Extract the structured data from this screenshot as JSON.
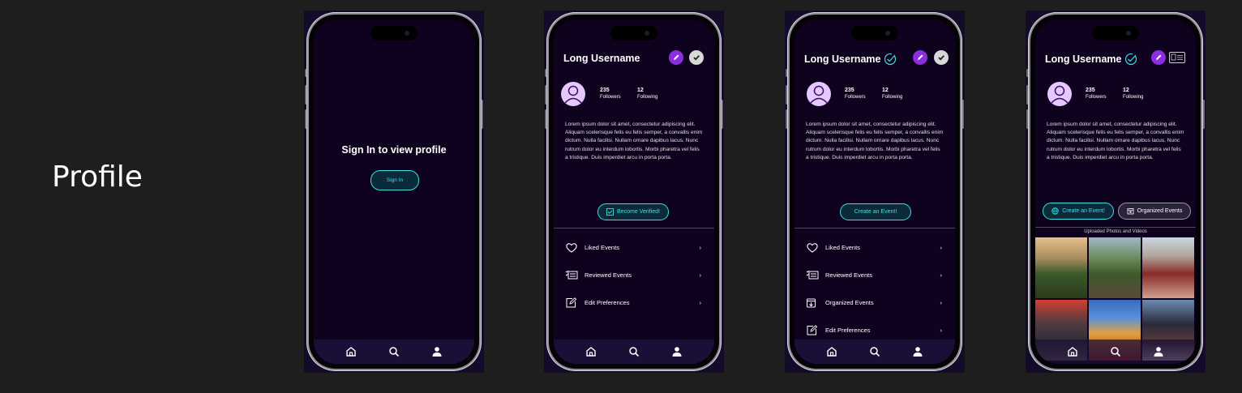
{
  "section_title": "Profile",
  "colors": {
    "background": "#1e1e1e",
    "screen": "#0e021e",
    "accent_cyan": "#3de0e0",
    "accent_purple": "#8b2ee0",
    "tabbar": "#1a0f36"
  },
  "phone1": {
    "title": "Sign In to view profile",
    "button": "Sign In"
  },
  "profile": {
    "username": "Long Username",
    "followers_count": "235",
    "followers_label": "Followers",
    "following_count": "12",
    "following_label": "Following",
    "bio": "Lorem ipsum dolor sit amet, consectetur adipiscing elit. Aliquam scelerisque felis eu felis semper, a convallis enim dictum. Nulla facilisi. Nullam ornare dapibus lacus. Nunc rutrum dolor eu interdum lobortis. Morbi pharetra vel felis a tristique. Duis imperdiet arcu in porta porta."
  },
  "phone2": {
    "button": "Become Verified!",
    "menu": [
      "Liked Events",
      "Reviewed Events",
      "Edit Preferences"
    ]
  },
  "phone3": {
    "button": "Create an Event!",
    "menu": [
      "Liked Events",
      "Reviewed Events",
      "Organized Events",
      "Edit Preferences"
    ]
  },
  "phone4": {
    "button_create": "Create an Event!",
    "button_organized": "Organized Events",
    "photos_title": "Uploaded Photos and Videos"
  },
  "icons": {
    "tabbar": [
      "home-icon",
      "search-icon",
      "person-icon"
    ],
    "header": [
      "pencil-icon",
      "check-icon",
      "verified-icon",
      "id-card-icon"
    ]
  }
}
